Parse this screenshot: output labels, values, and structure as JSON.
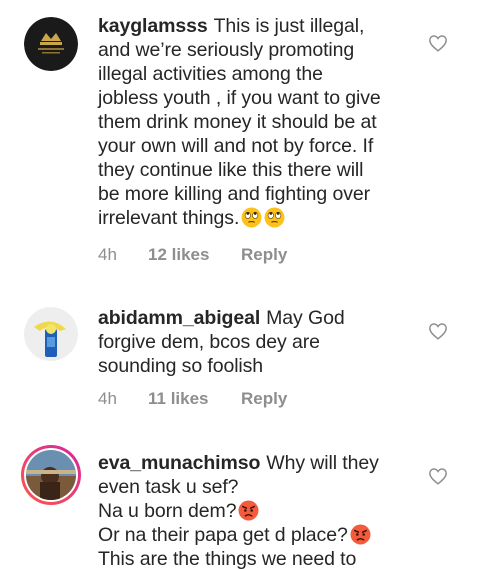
{
  "comments": [
    {
      "username": "kayglamsss",
      "lines": [
        "This is just illegal,",
        "and we’re seriously promoting",
        "illegal activities among the",
        "jobless youth , if you want to give",
        "them drink money it should be at",
        "your own will and not by force. If",
        "they continue like this there will",
        "be more killing and fighting over",
        "irrelevant things."
      ],
      "emoji": "face-with-rolling-eyes-icon",
      "time": "4h",
      "likes": "12 likes",
      "reply": "Reply"
    },
    {
      "username": "abidamm_abigeal",
      "lines": [
        "May God",
        "forgive dem, bcos dey are",
        "sounding so foolish"
      ],
      "time": "4h",
      "likes": "11 likes",
      "reply": "Reply"
    },
    {
      "username": "eva_munachimso",
      "lines": [
        "Why will they",
        "even task u sef?",
        "Na u born dem?",
        "Or na their papa get d place?",
        "This are the things we need to"
      ],
      "emoji": "angry-face-icon"
    }
  ],
  "colors": {
    "text": "#262626",
    "meta": "#8e8e8e",
    "story_ring_start": "#d6249f",
    "story_ring_end": "#fd5949"
  }
}
